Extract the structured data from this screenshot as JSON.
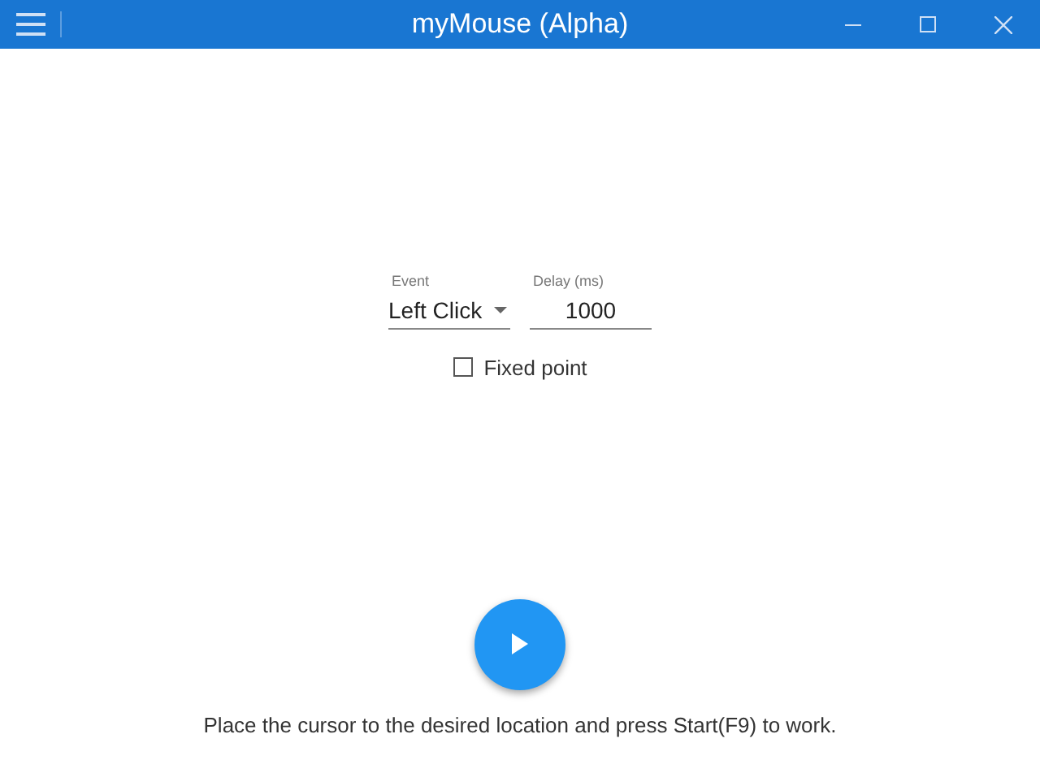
{
  "window": {
    "title": "myMouse (Alpha)"
  },
  "event": {
    "label": "Event",
    "value": "Left Click"
  },
  "delay": {
    "label": "Delay (ms)",
    "value": "1000"
  },
  "fixed_point": {
    "label": "Fixed point",
    "checked": false
  },
  "status": "Place the cursor to the desired location and press Start(F9) to work."
}
